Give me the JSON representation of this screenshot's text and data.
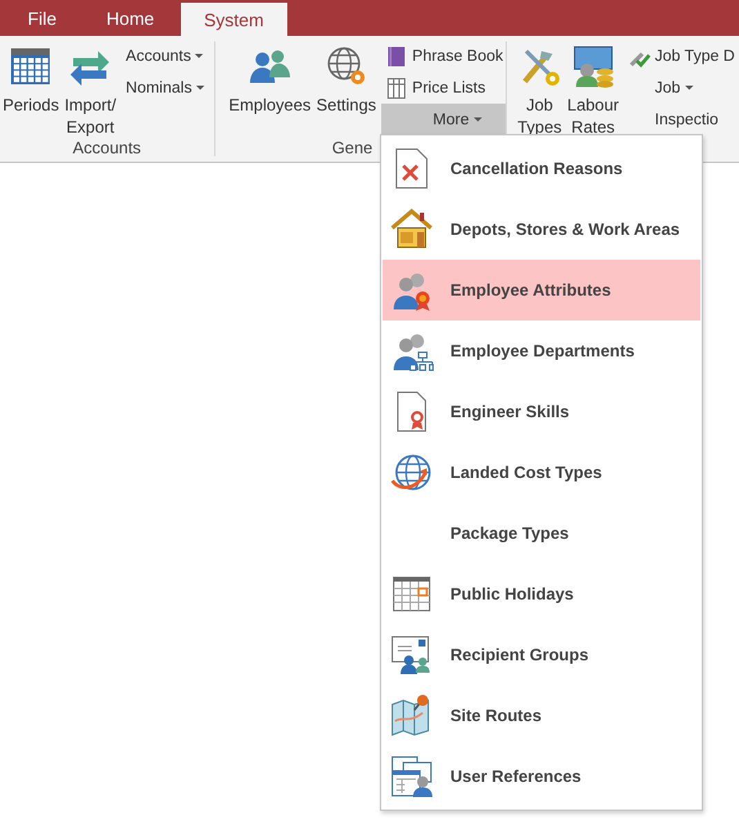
{
  "menu_bar": {
    "tabs": [
      {
        "label": "File",
        "selected": false
      },
      {
        "label": "Home",
        "selected": false
      },
      {
        "label": "System",
        "selected": true
      }
    ]
  },
  "ribbon": {
    "groups": [
      {
        "label": "Accounts",
        "large_buttons": [
          {
            "lines": [
              "Periods"
            ]
          },
          {
            "lines": [
              "Import/",
              "Export"
            ]
          }
        ],
        "small_buttons": [
          {
            "label": "Accounts",
            "dropdown": true
          },
          {
            "label": "Nominals",
            "dropdown": true
          }
        ]
      },
      {
        "label": "Gene",
        "large_buttons": [
          {
            "lines": [
              "Employees"
            ]
          },
          {
            "lines": [
              "Settings"
            ]
          }
        ],
        "small_buttons": [
          {
            "label": "Phrase Book",
            "dropdown": false
          },
          {
            "label": "Price Lists",
            "dropdown": false
          },
          {
            "label": "More",
            "dropdown": true,
            "pressed": true
          }
        ]
      },
      {
        "large_buttons": [
          {
            "lines": [
              "Job",
              "Types"
            ]
          },
          {
            "lines": [
              "Labour",
              "Rates"
            ]
          }
        ],
        "small_buttons": [
          {
            "label": "Job Type D",
            "dropdown": false
          },
          {
            "label": "Job",
            "dropdown": true
          },
          {
            "label": "Inspectio",
            "dropdown": false
          }
        ]
      }
    ]
  },
  "more_menu": {
    "items": [
      {
        "label": "Cancellation Reasons",
        "selected": false
      },
      {
        "label": "Depots, Stores & Work Areas",
        "selected": false
      },
      {
        "label": "Employee Attributes",
        "selected": true
      },
      {
        "label": "Employee Departments",
        "selected": false
      },
      {
        "label": "Engineer Skills",
        "selected": false
      },
      {
        "label": "Landed Cost Types",
        "selected": false
      },
      {
        "label": "Package Types",
        "selected": false
      },
      {
        "label": "Public Holidays",
        "selected": false
      },
      {
        "label": "Recipient Groups",
        "selected": false
      },
      {
        "label": "Site Routes",
        "selected": false
      },
      {
        "label": "User References",
        "selected": false
      }
    ]
  }
}
